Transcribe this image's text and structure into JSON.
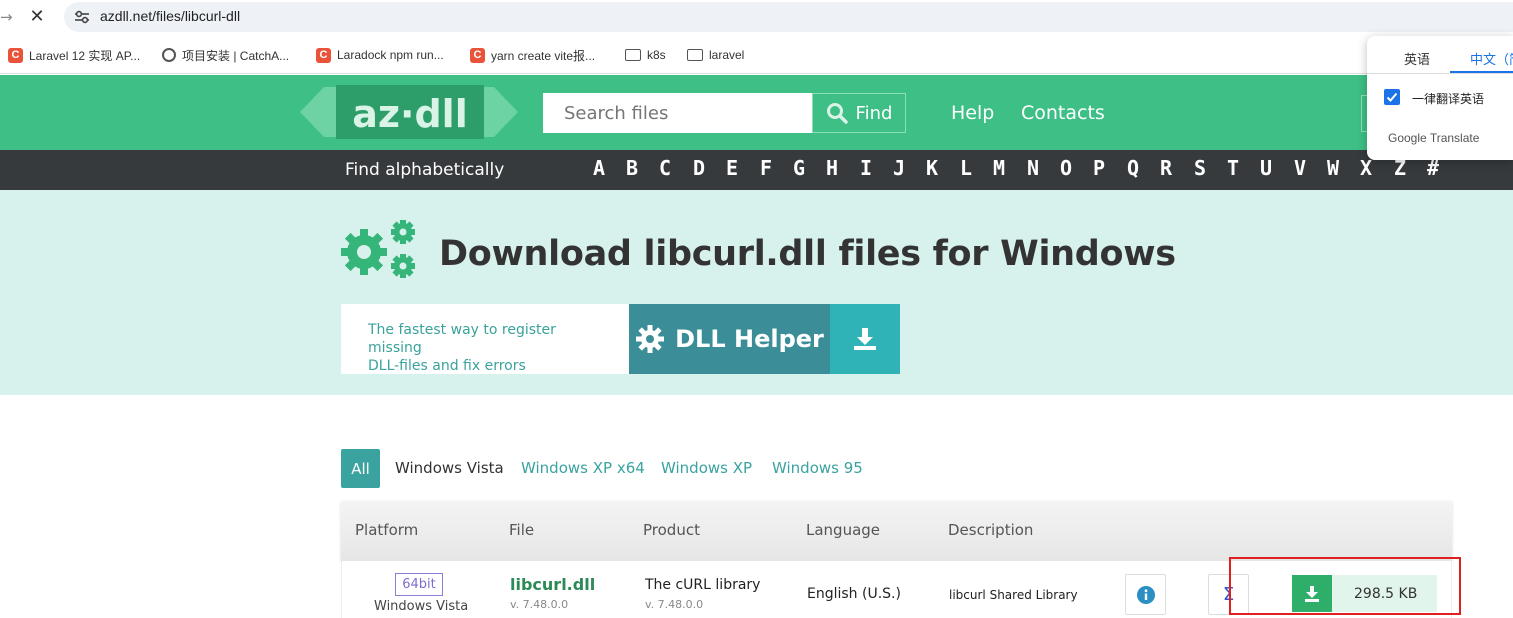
{
  "browser": {
    "url": "azdll.net/files/libcurl-dll",
    "bookmarks": [
      {
        "label": "Laravel 12 实现 AP...",
        "icon": "c-favicon"
      },
      {
        "label": "项目安装 | CatchA...",
        "icon": "globe-icon"
      },
      {
        "label": "Laradock npm run...",
        "icon": "c-favicon"
      },
      {
        "label": "yarn create vite报...",
        "icon": "c-favicon"
      },
      {
        "label": "k8s",
        "icon": "folder-icon"
      },
      {
        "label": "laravel",
        "icon": "folder-icon"
      }
    ]
  },
  "translate_popup": {
    "tab_source": "英语",
    "tab_target": "中文（简",
    "always_translate": "一律翻译英语",
    "brand": "Google Translate"
  },
  "header": {
    "logo": "az·dll",
    "search_placeholder": "Search files",
    "find_label": "Find",
    "links": [
      "Help",
      "Contacts"
    ]
  },
  "alphabet": {
    "label": "Find alphabetically",
    "letters": [
      "A",
      "B",
      "C",
      "D",
      "E",
      "F",
      "G",
      "H",
      "I",
      "J",
      "K",
      "L",
      "M",
      "N",
      "O",
      "P",
      "Q",
      "R",
      "S",
      "T",
      "U",
      "V",
      "W",
      "X",
      "Z",
      "#"
    ]
  },
  "hero": {
    "title": "Download libcurl.dll files for Windows",
    "promo_line1": "The fastest way to register missing",
    "promo_line2": "DLL-files and fix errors",
    "helper_label": "DLL Helper"
  },
  "tabs": {
    "active": "All",
    "items": [
      "Windows Vista",
      "Windows XP x64",
      "Windows XP",
      "Windows 95"
    ]
  },
  "table": {
    "headers": [
      "Platform",
      "File",
      "Product",
      "Language",
      "Description"
    ],
    "rows": [
      {
        "badge": "64bit",
        "platform": "Windows Vista",
        "file": "libcurl.dll",
        "file_version": "v. 7.48.0.0",
        "product": "The cURL library",
        "product_version": "v. 7.48.0.0",
        "language": "English (U.S.)",
        "description": "libcurl Shared Library",
        "size": "298.5 KB"
      }
    ]
  },
  "colors": {
    "brand_green": "#3dbf85",
    "dark_bar": "#363a3d",
    "hero_bg": "#d7f1ec",
    "teal": "#3aa3a0",
    "highlight_red": "#e02020"
  }
}
